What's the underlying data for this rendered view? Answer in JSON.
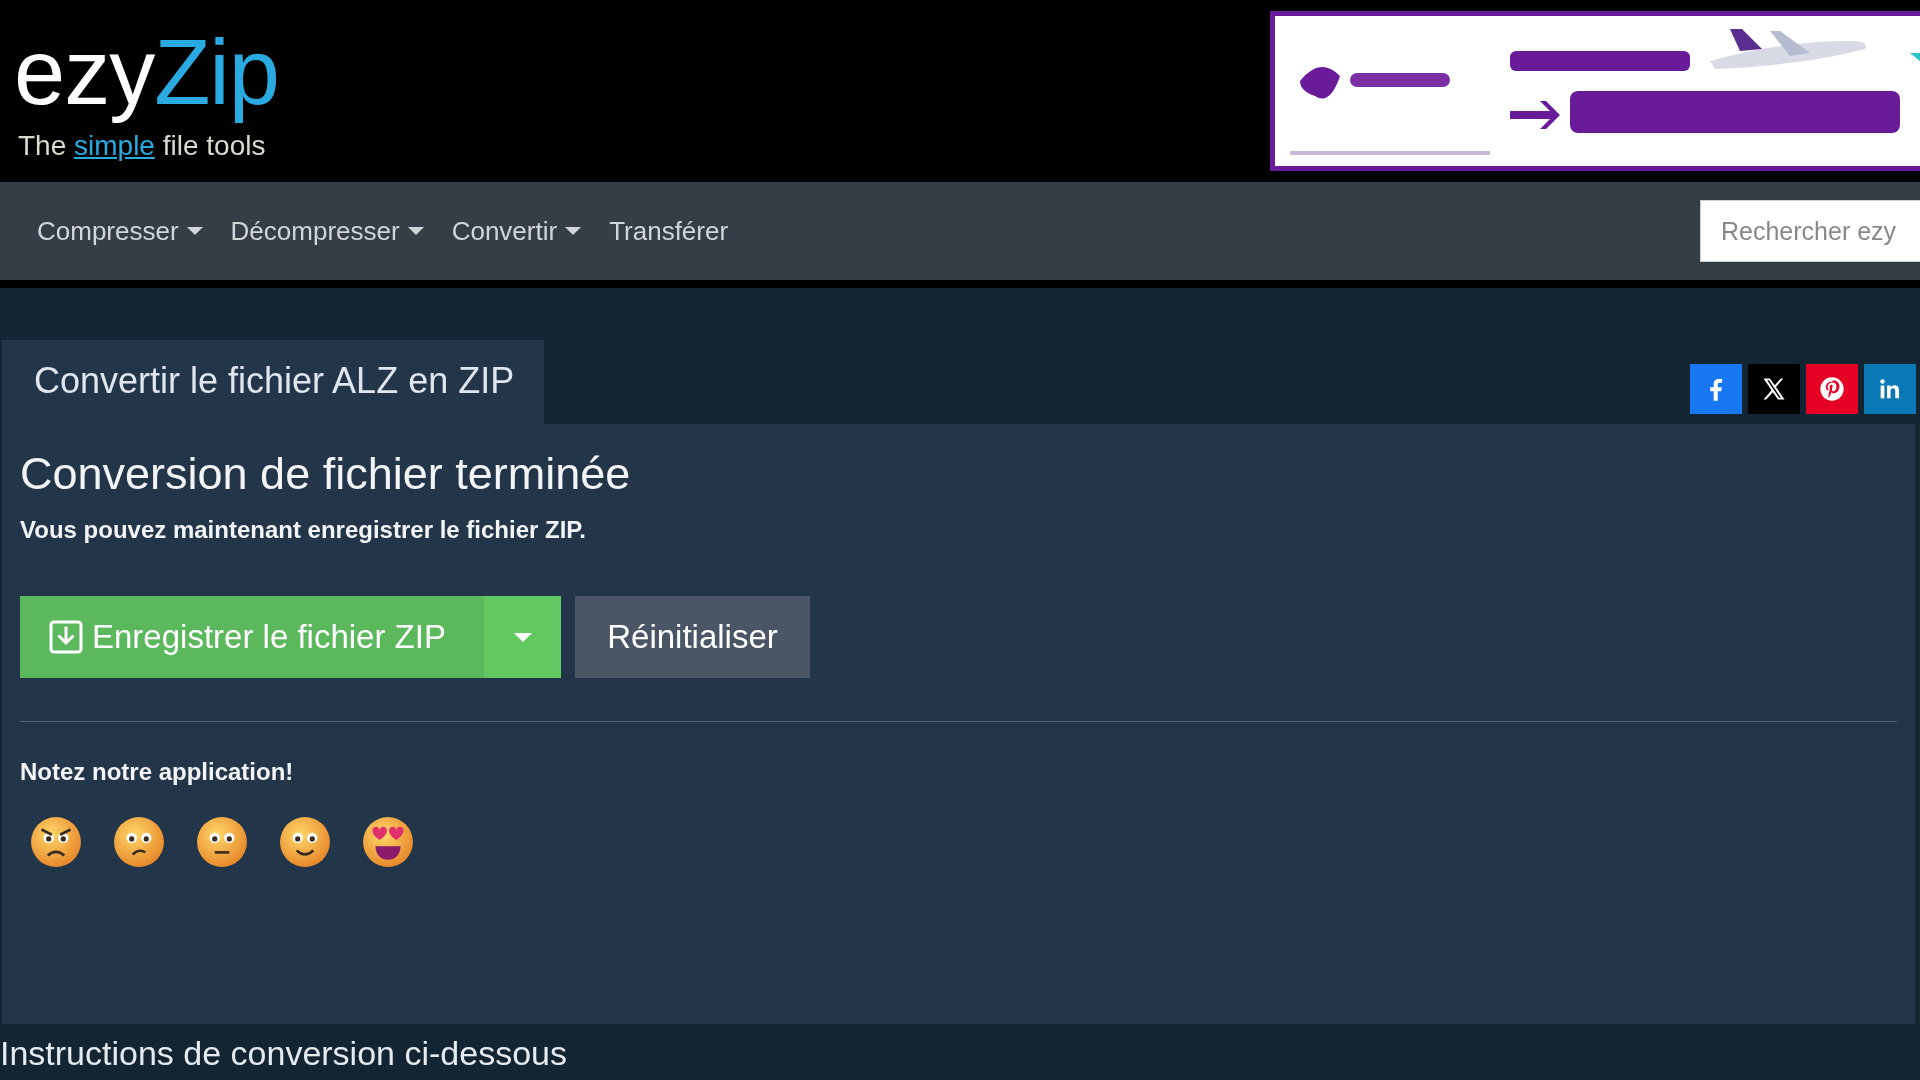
{
  "logo": {
    "name_start": "ezy",
    "name_end": "Zip",
    "tagline_before": "The",
    "tagline_highlight": "simple",
    "tagline_after": "file tools"
  },
  "nav": [
    {
      "label": "Compresser",
      "dropdown": true
    },
    {
      "label": "Décompresser",
      "dropdown": true
    },
    {
      "label": "Convertir",
      "dropdown": true
    },
    {
      "label": "Transférer",
      "dropdown": false
    }
  ],
  "search": {
    "placeholder": "Rechercher ezy"
  },
  "tab": {
    "title": "Convertir le fichier ALZ en ZIP"
  },
  "social": [
    {
      "kind": "facebook"
    },
    {
      "kind": "x"
    },
    {
      "kind": "pinterest"
    },
    {
      "kind": "linkedin"
    }
  ],
  "heading": "Conversion de fichier terminée",
  "message": "Vous pouvez maintenant enregistrer le fichier ZIP.",
  "save_button": "Enregistrer le fichier ZIP",
  "reset_button": "Réinitialiser",
  "rating": {
    "title": "Notez notre application!",
    "faces": [
      {
        "kind": "angry"
      },
      {
        "kind": "sad"
      },
      {
        "kind": "neutral"
      },
      {
        "kind": "happy"
      },
      {
        "kind": "love"
      }
    ]
  },
  "footer_heading": "Instructions de conversion ci-dessous"
}
